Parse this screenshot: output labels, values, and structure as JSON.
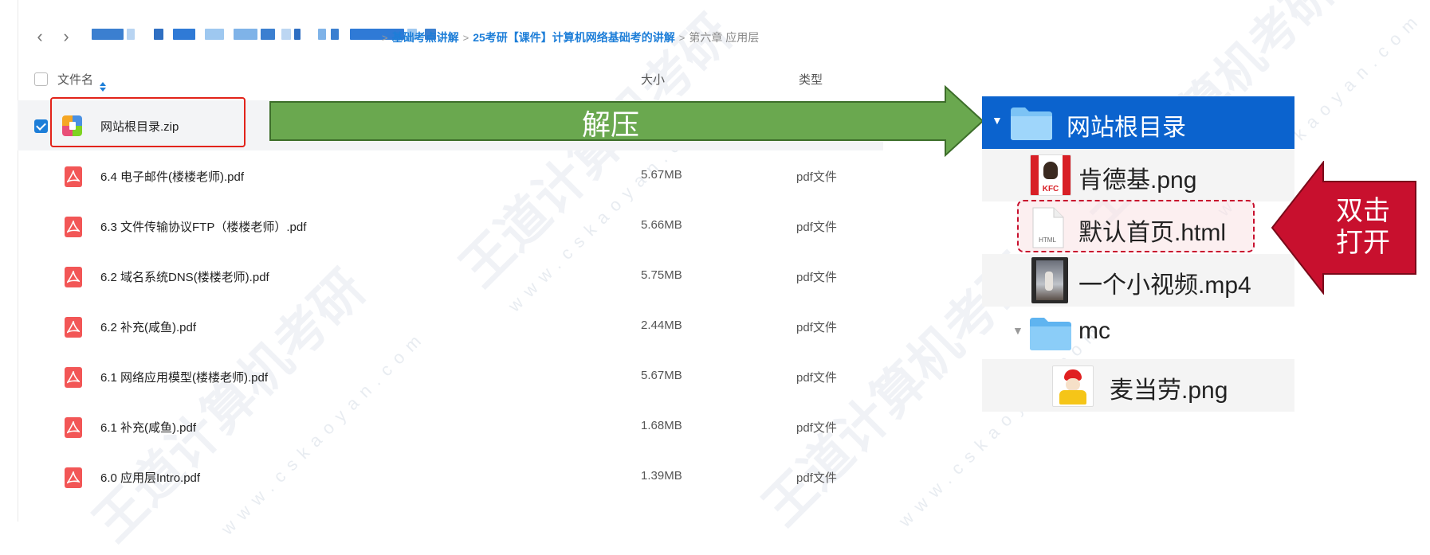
{
  "nav": {
    "back_icon": "chevron-left-icon",
    "forward_icon": "chevron-right-icon",
    "back_glyph": "‹",
    "forward_glyph": "›"
  },
  "breadcrumb": {
    "items": [
      "基础考点讲解",
      "25考研【课件】计算机网络基础考的讲解"
    ],
    "current": "第六章 应用层",
    "separator": ">"
  },
  "list": {
    "headers": {
      "name": "文件名",
      "size": "大小",
      "type": "类型"
    },
    "selected_file": {
      "name": "网站根目录.zip"
    },
    "files": [
      {
        "name": "6.4 电子邮件(楼楼老师).pdf",
        "size": "5.67MB",
        "type": "pdf文件"
      },
      {
        "name": "6.3 文件传输协议FTP（楼楼老师）.pdf",
        "size": "5.66MB",
        "type": "pdf文件"
      },
      {
        "name": "6.2 域名系统DNS(楼楼老师).pdf",
        "size": "5.75MB",
        "type": "pdf文件"
      },
      {
        "name": "6.2 补充(咸鱼).pdf",
        "size": "2.44MB",
        "type": "pdf文件"
      },
      {
        "name": "6.1 网络应用模型(楼楼老师).pdf",
        "size": "5.67MB",
        "type": "pdf文件"
      },
      {
        "name": "6.1 补充(咸鱼).pdf",
        "size": "1.68MB",
        "type": "pdf文件"
      },
      {
        "name": "6.0 应用层Intro.pdf",
        "size": "1.39MB",
        "type": "pdf文件"
      }
    ]
  },
  "annotations": {
    "unzip": "解压",
    "double_click_line1": "双击",
    "double_click_line2": "打开"
  },
  "tree": {
    "root": "网站根目录",
    "items": [
      {
        "label": "肯德基.png",
        "thumb_text": "KFC"
      },
      {
        "label": "默认首页.html",
        "thumb_text": "HTML"
      },
      {
        "label": "一个小视频.mp4"
      },
      {
        "label": "mc"
      },
      {
        "label": "麦当劳.png"
      }
    ]
  },
  "colors": {
    "accent": "#1d7ed8",
    "selected_folder": "#0b63ce",
    "arrow_green": "#6aa84f",
    "arrow_red": "#c8102e",
    "highlight_red": "#e2231a"
  }
}
